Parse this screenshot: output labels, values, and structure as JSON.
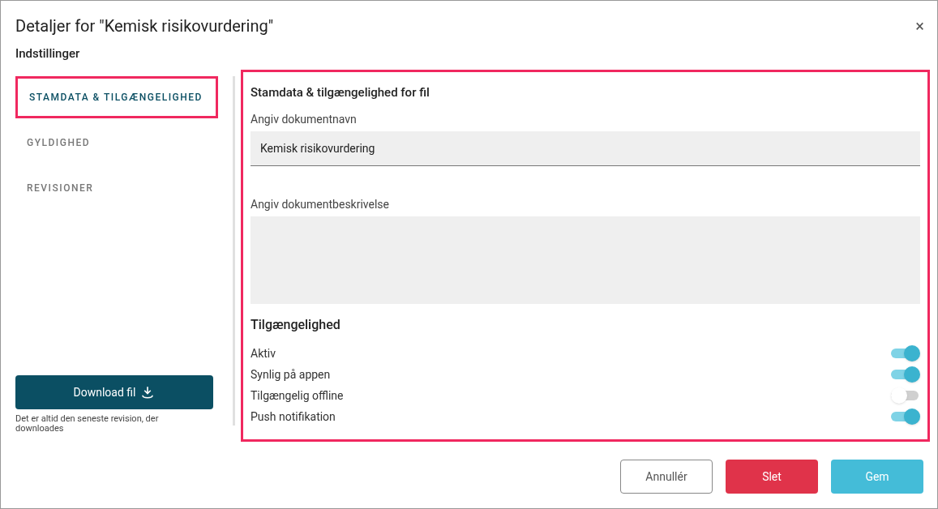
{
  "dialog": {
    "title": "Detaljer for \"Kemisk risikovurdering\"",
    "close": "×",
    "subtitle": "Indstillinger"
  },
  "sidebar": {
    "tabs": [
      {
        "label": "STAMDATA & TILGÆNGELIGHED",
        "selected": true
      },
      {
        "label": "GYLDIGHED",
        "selected": false
      },
      {
        "label": "REVISIONER",
        "selected": false
      }
    ],
    "download_button": "Download fil",
    "download_note": "Det er altid den seneste revision, der downloades"
  },
  "panel": {
    "heading": "Stamdata & tilgængelighed for fil",
    "name_field": {
      "label": "Angiv dokumentnavn",
      "value": "Kemisk risikovurdering"
    },
    "description_field": {
      "label": "Angiv dokumentbeskrivelse"
    },
    "availability_heading": "Tilgængelighed",
    "toggles": [
      {
        "label": "Aktiv",
        "on": true
      },
      {
        "label": "Synlig på appen",
        "on": true
      },
      {
        "label": "Tilgængelig offline",
        "on": false
      },
      {
        "label": "Push notifikation",
        "on": true
      }
    ]
  },
  "footer": {
    "cancel": "Annullér",
    "delete": "Slet",
    "save": "Gem"
  }
}
